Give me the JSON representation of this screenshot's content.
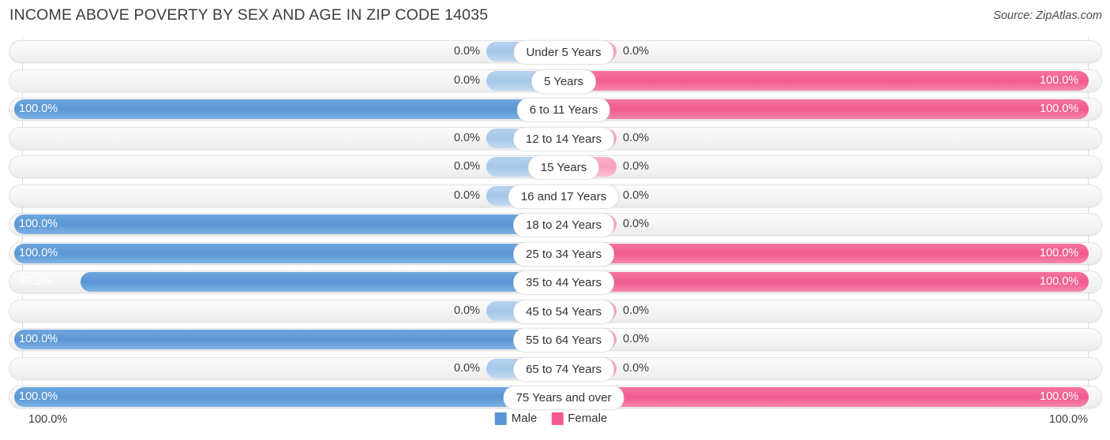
{
  "header": {
    "title": "INCOME ABOVE POVERTY BY SEX AND AGE IN ZIP CODE 14035",
    "source": "Source: ZipAtlas.com"
  },
  "legend": {
    "male_label": "Male",
    "female_label": "Female",
    "male_color": "#5b96d4",
    "female_color": "#f15b90"
  },
  "axis": {
    "left_label": "100.0%",
    "right_label": "100.0%"
  },
  "chart_data": {
    "type": "bar",
    "title": "INCOME ABOVE POVERTY BY SEX AND AGE IN ZIP CODE 14035",
    "subtitle": "Source: ZipAtlas.com",
    "orientation": "horizontal-diverging",
    "xlabel": "",
    "ylabel": "",
    "xlim": [
      0,
      100
    ],
    "grid": true,
    "legend_position": "bottom-center",
    "categories": [
      "Under 5 Years",
      "5 Years",
      "6 to 11 Years",
      "12 to 14 Years",
      "15 Years",
      "16 and 17 Years",
      "18 to 24 Years",
      "25 to 34 Years",
      "35 to 44 Years",
      "45 to 54 Years",
      "55 to 64 Years",
      "65 to 74 Years",
      "75 Years and over"
    ],
    "series": [
      {
        "name": "Male",
        "values": [
          0.0,
          0.0,
          100.0,
          0.0,
          0.0,
          0.0,
          100.0,
          100.0,
          87.5,
          0.0,
          100.0,
          0.0,
          100.0
        ],
        "labels": [
          "0.0%",
          "0.0%",
          "100.0%",
          "0.0%",
          "0.0%",
          "0.0%",
          "100.0%",
          "100.0%",
          "87.5%",
          "0.0%",
          "100.0%",
          "0.0%",
          "100.0%"
        ]
      },
      {
        "name": "Female",
        "values": [
          0.0,
          100.0,
          100.0,
          0.0,
          0.0,
          0.0,
          0.0,
          100.0,
          100.0,
          0.0,
          0.0,
          0.0,
          100.0
        ],
        "labels": [
          "0.0%",
          "100.0%",
          "100.0%",
          "0.0%",
          "0.0%",
          "0.0%",
          "0.0%",
          "100.0%",
          "100.0%",
          "0.0%",
          "0.0%",
          "0.0%",
          "100.0%"
        ]
      }
    ]
  }
}
